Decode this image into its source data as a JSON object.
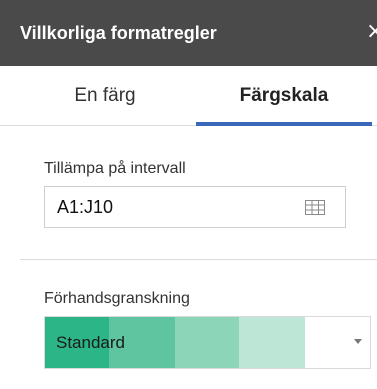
{
  "header": {
    "title": "Villkorliga formatregler",
    "close_icon": "×",
    "background_color": "#4a4a4a"
  },
  "tabs": [
    {
      "label": "En färg",
      "active": false
    },
    {
      "label": "Färgskala",
      "active": true
    }
  ],
  "accent_color": "#3b67b9",
  "range": {
    "label": "Tillämpa på intervall",
    "value": "A1:J10",
    "icon": "grid-icon"
  },
  "preview": {
    "label": "Förhandsgranskning",
    "selected": "Standard",
    "colors": [
      "#2cb586",
      "#5fc5a0",
      "#8dd5b9",
      "#bde6d6",
      "#ffffff"
    ],
    "icon": "dropdown-arrow-icon"
  }
}
